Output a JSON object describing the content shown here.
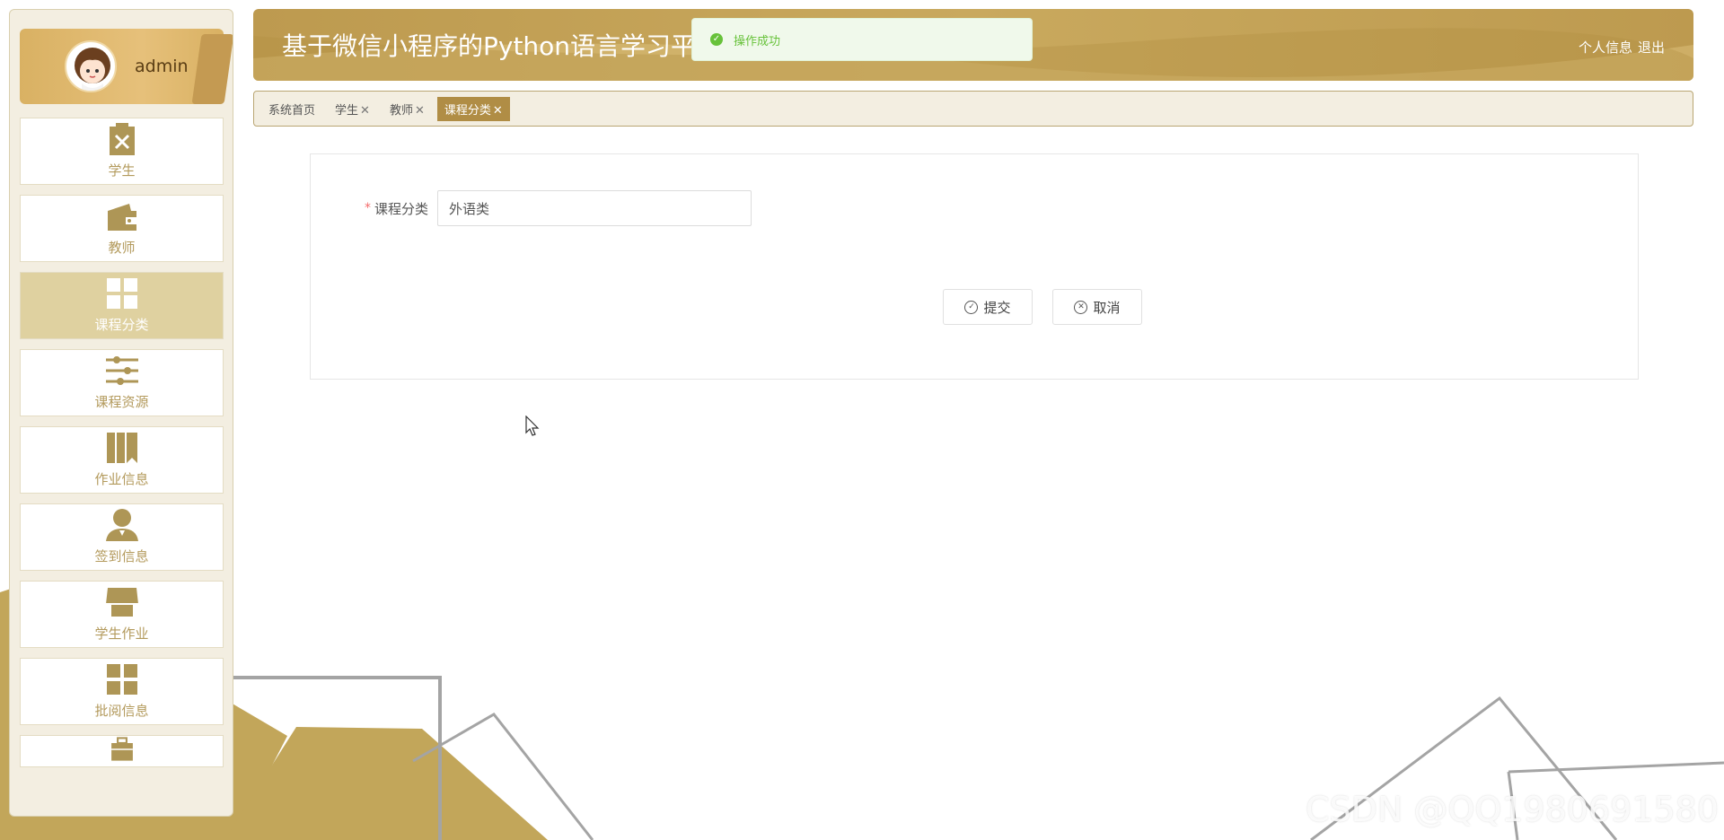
{
  "user": {
    "name": "admin"
  },
  "sidebar": {
    "items": [
      {
        "label": "学生",
        "icon": "clipboard-x-icon"
      },
      {
        "label": "教师",
        "icon": "wallet-icon"
      },
      {
        "label": "课程分类",
        "icon": "grid-icon",
        "active": true
      },
      {
        "label": "课程资源",
        "icon": "sliders-icon"
      },
      {
        "label": "作业信息",
        "icon": "book-icon"
      },
      {
        "label": "签到信息",
        "icon": "user-icon"
      },
      {
        "label": "学生作业",
        "icon": "shop-icon"
      },
      {
        "label": "批阅信息",
        "icon": "grid-icon"
      },
      {
        "label": "",
        "icon": "briefcase-icon"
      }
    ]
  },
  "header": {
    "title": "基于微信小程序的Python语言学习平",
    "links": [
      "个人信息",
      "退出"
    ]
  },
  "toast": {
    "text": "操作成功"
  },
  "tabs": [
    {
      "label": "系统首页",
      "closable": false
    },
    {
      "label": "学生",
      "closable": true
    },
    {
      "label": "教师",
      "closable": true
    },
    {
      "label": "课程分类",
      "closable": true,
      "active": true
    }
  ],
  "form": {
    "required_mark": "*",
    "label": "课程分类",
    "value": "外语类",
    "submit": "提交",
    "cancel": "取消"
  },
  "watermark": "CSDN @QQ1980691580",
  "colors": {
    "accent": "#bd9a4f",
    "active_tab": "#b08d45",
    "success": "#67c23a"
  }
}
